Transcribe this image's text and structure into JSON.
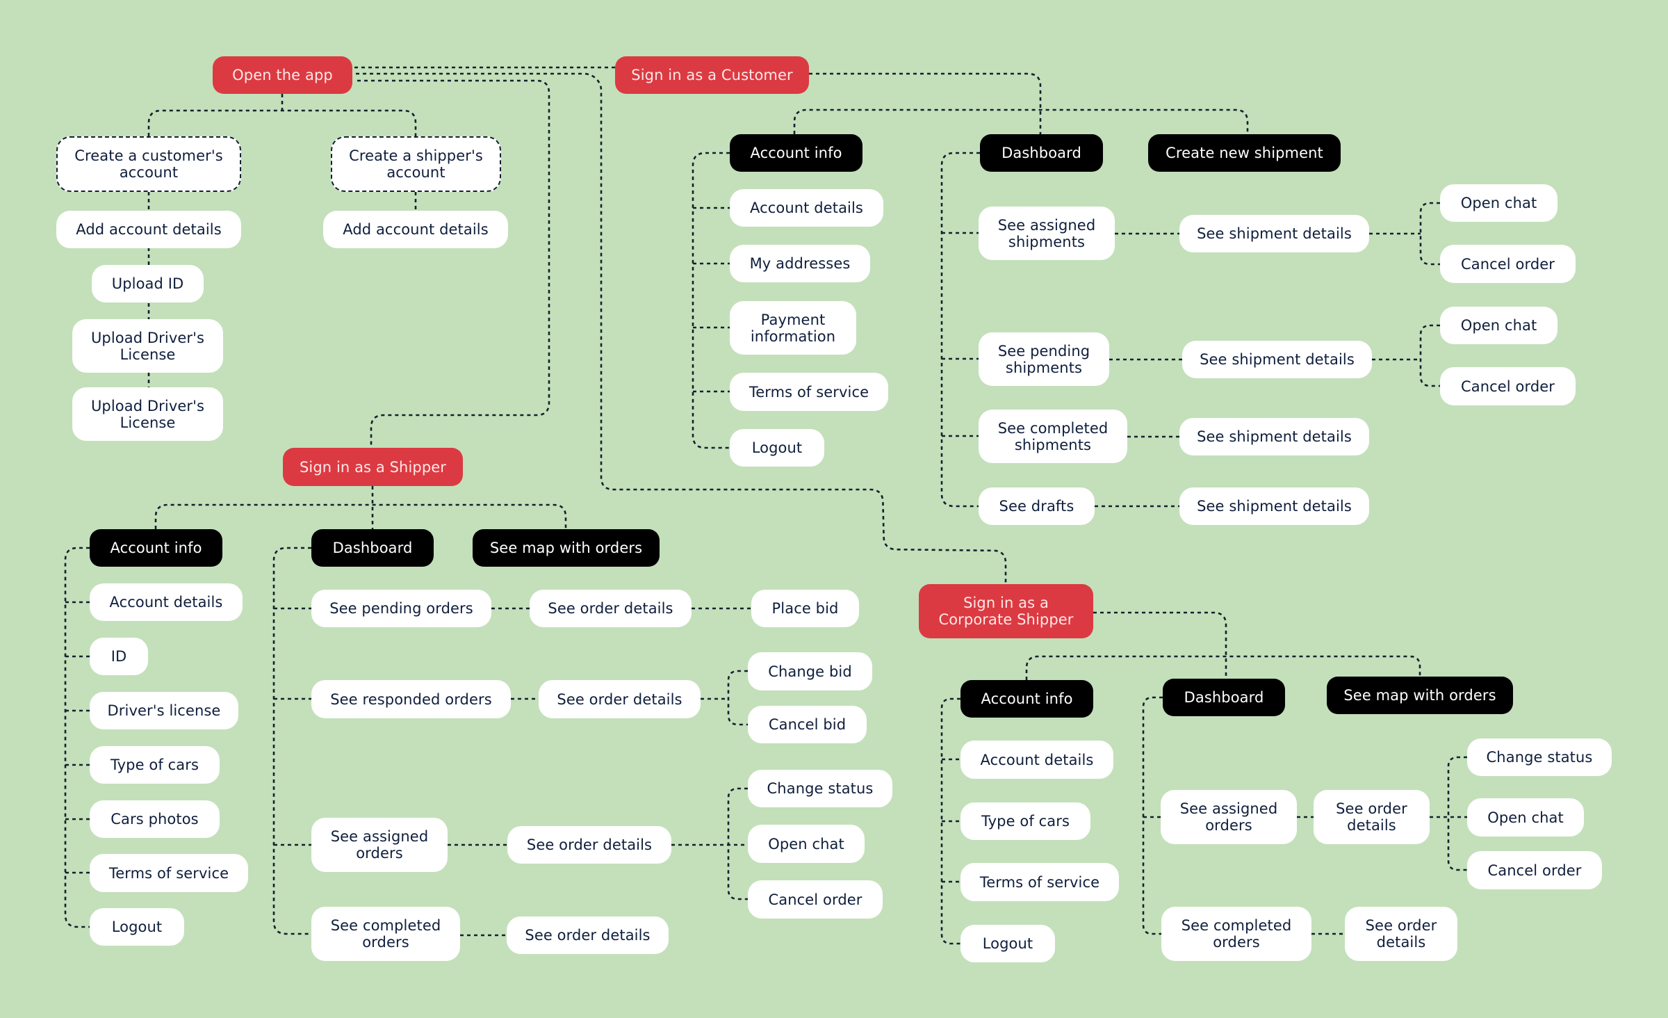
{
  "colors": {
    "background": "#c3e0ba",
    "entry_node": "#dc3a42",
    "section_node": "#000000",
    "action_node": "#ffffff",
    "text": "#0f1e3c",
    "connector": "#14202e"
  },
  "root": {
    "open_app": "Open the app",
    "create_customer_account": "Create a customer's\naccount",
    "create_shipper_account": "Create a shipper's\naccount",
    "customer_signup": [
      "Add account details",
      "Upload ID",
      "Upload Driver's\nLicense",
      "Upload Driver's\nLicense"
    ],
    "shipper_signup": [
      "Add account details"
    ]
  },
  "customer": {
    "entry": "Sign in as a Customer",
    "account_info": {
      "label": "Account info",
      "items": [
        "Account details",
        "My addresses",
        "Payment\ninformation",
        "Terms of service",
        "Logout"
      ]
    },
    "dashboard": {
      "label": "Dashboard",
      "items": [
        {
          "label": "See assigned\nshipments",
          "details": "See shipment details",
          "actions": [
            "Open chat",
            "Cancel order"
          ]
        },
        {
          "label": "See pending\nshipments",
          "details": "See shipment details",
          "actions": [
            "Open chat",
            "Cancel order"
          ]
        },
        {
          "label": "See completed\nshipments",
          "details": "See shipment details",
          "actions": []
        },
        {
          "label": "See drafts",
          "details": "See shipment details",
          "actions": []
        }
      ]
    },
    "create_shipment": "Create new shipment"
  },
  "shipper": {
    "entry": "Sign in as a Shipper",
    "account_info": {
      "label": "Account info",
      "items": [
        "Account details",
        "ID",
        "Driver's license",
        "Type of cars",
        "Cars photos",
        "Terms of service",
        "Logout"
      ]
    },
    "dashboard": {
      "label": "Dashboard",
      "items": [
        {
          "label": "See pending orders",
          "details": "See order details",
          "actions": [
            "Place bid"
          ]
        },
        {
          "label": "See responded orders",
          "details": "See order details",
          "actions": [
            "Change bid",
            "Cancel bid"
          ]
        },
        {
          "label": "See assigned\norders",
          "details": "See order details",
          "actions": [
            "Change status",
            "Open chat",
            "Cancel order"
          ]
        },
        {
          "label": "See completed\norders",
          "details": "See order details",
          "actions": []
        }
      ]
    },
    "map": "See map with orders"
  },
  "corporate": {
    "entry": "Sign in as a\nCorporate Shipper",
    "account_info": {
      "label": "Account info",
      "items": [
        "Account details",
        "Type of cars",
        "Terms of service",
        "Logout"
      ]
    },
    "dashboard": {
      "label": "Dashboard",
      "items": [
        {
          "label": "See assigned\norders",
          "details": "See order\ndetails",
          "actions": [
            "Change status",
            "Open chat",
            "Cancel order"
          ]
        },
        {
          "label": "See completed\norders",
          "details": "See order\ndetails",
          "actions": []
        }
      ]
    },
    "map": "See map with orders"
  }
}
